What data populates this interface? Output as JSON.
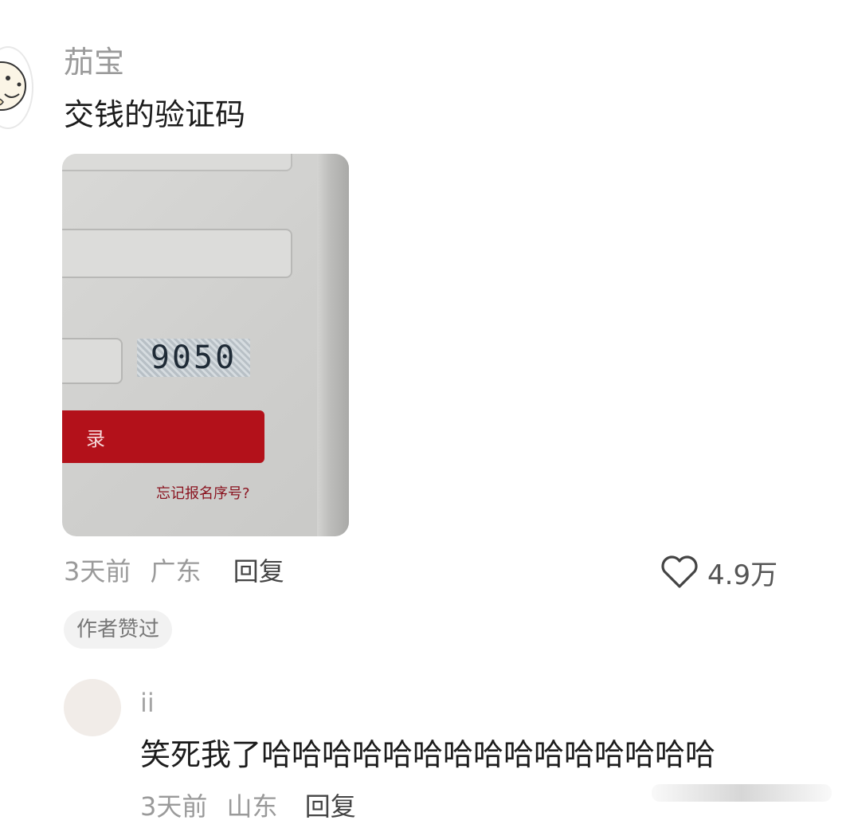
{
  "comment": {
    "username": "茄宝",
    "text": "交钱的验证码",
    "photo": {
      "captcha_code": "9050",
      "button_label": "录",
      "forgot_link": "忘记报名序号?"
    },
    "time": "3天前",
    "location": "广东",
    "reply_label": "回复",
    "like_count": "4.9万",
    "author_liked_badge": "作者赞过"
  },
  "reply": {
    "username": "ii",
    "text": "笑死我了哈哈哈哈哈哈哈哈哈哈哈哈哈哈哈",
    "time": "3天前",
    "location": "山东",
    "reply_label": "回复"
  },
  "colors": {
    "accent_red": "#b3111a",
    "muted_text": "#9a9a9a"
  }
}
